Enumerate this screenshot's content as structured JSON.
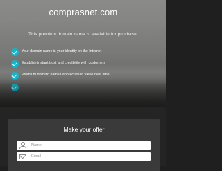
{
  "hero": {
    "domain": "comprasnet.com",
    "subtitle": "This premium domain name is available for purchase!",
    "features": [
      "Your domain name is your identity on the Internet",
      "Establish instant trust and credibility with customers",
      "Premium domain names appreciate in value over time",
      ""
    ]
  },
  "offer": {
    "title": "Make your offer",
    "name_placeholder": "Name",
    "email_placeholder": "Email"
  },
  "colors": {
    "accent": "#16b4c9",
    "panel": "#3a3a3a"
  },
  "icons": {
    "feature": "check-icon",
    "name": "user-icon",
    "email": "mail-icon"
  }
}
